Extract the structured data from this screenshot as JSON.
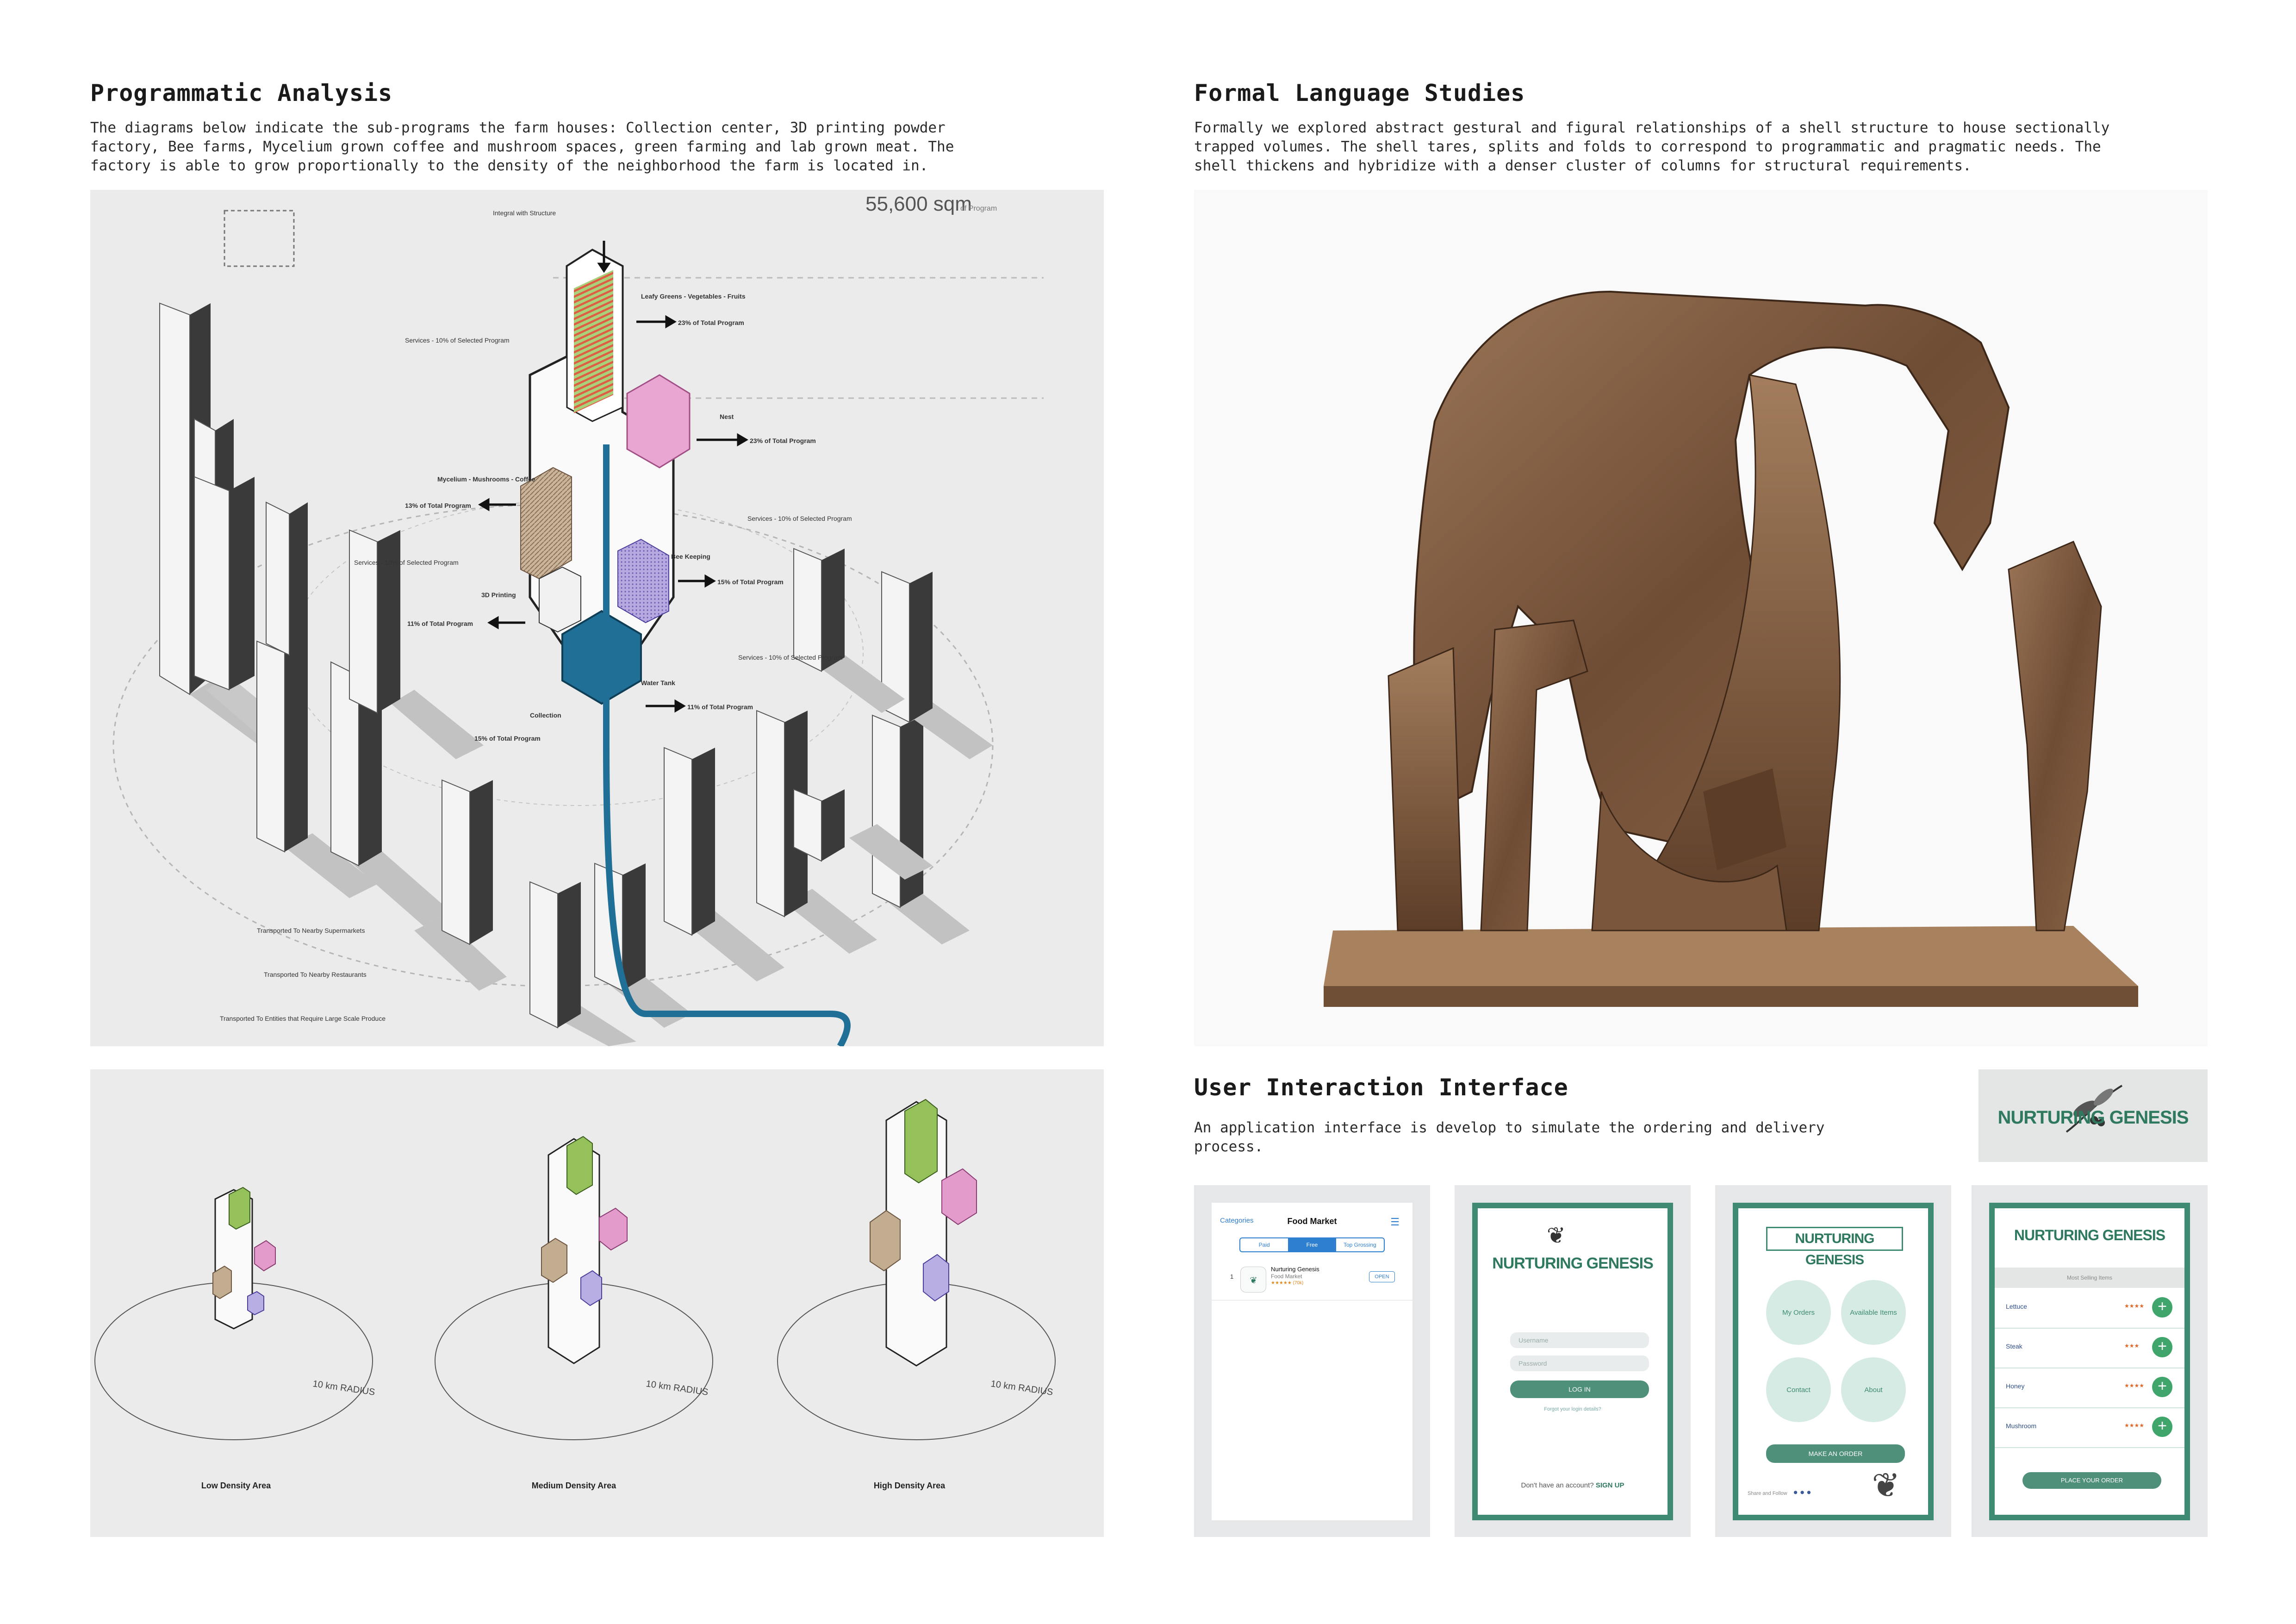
{
  "left": {
    "title": "Programmatic Analysis",
    "lines": [
      "The diagrams below indicate the sub-programs the farm houses: Collection center, 3D printing powder",
      "factory, Bee farms, Mycelium grown coffee and mushroom spaces, green farming and lab grown meat. The",
      "factory is able to grow proportionally to the density of the neighborhood the farm is located in."
    ],
    "diagram": {
      "area": "55,600 sqm",
      "area_note": "of Program",
      "labels": {
        "integral": "Integral with Structure",
        "leafy": "Leafy Greens - Vegetables - Fruits",
        "p23": "23% of Total Program",
        "nest": "Nest",
        "p23b": "23% of Total Program",
        "mycelium": "Mycelium - Mushrooms - Coffee",
        "p13": "13% of Total Program",
        "bee": "Bee Keeping",
        "p15": "15% of Total Program",
        "printing": "3D Printing",
        "p11": "11% of Total Program",
        "water": "Water Tank",
        "p11b": "11% of Total Program",
        "collection": "Collection",
        "p15b": "15% of Total Program",
        "services1": "Services - 10% of Selected Program",
        "services2": "Services - 10% of Selected Program",
        "services3": "Services - 10% of Selected Program",
        "services4": "Services - 10% of Selected Program",
        "t1": "Transported To Nearby Supermarkets",
        "t2": "Transported To Nearby Restaurants",
        "t3": "Transported To Entities that Require Large Scale Produce"
      }
    },
    "density": {
      "radius": "10 km RADIUS",
      "labels": [
        "Low Density Area",
        "Medium Density Area",
        "High Density Area"
      ]
    }
  },
  "right": {
    "title": "Formal Language Studies",
    "lines": [
      "Formally we explored abstract gestural and figural relationships of a shell structure to house sectionally",
      "trapped volumes. The shell tares, splits and folds to correspond to programmatic and pragmatic needs. The",
      "shell thickens and hybridize with a denser cluster of columns for structural requirements."
    ]
  },
  "ui": {
    "title": "User Interaction Interface",
    "lines": [
      "An application interface is develop to simulate the ordering and delivery",
      "process."
    ],
    "logo": "NURTURING GENESIS",
    "screen1": {
      "back": "Categories",
      "title": "Food Market",
      "segments": [
        "Paid",
        "Free",
        "Top Grossing"
      ],
      "rank": "1",
      "app_name": "Nurturing Genesis",
      "app_cat": "Food Market",
      "rating": "★★★★★ (70k)",
      "open": "OPEN"
    },
    "screen2": {
      "brand": "NURTURING GENESIS",
      "username": "Username",
      "password": "Password",
      "login": "LOG IN",
      "forgot": "Forgot your login details?",
      "no_account": "Don't have an account?",
      "signup": "SIGN UP"
    },
    "screen3": {
      "brand": "NURTURING GENESIS",
      "circles": [
        "My Orders",
        "Available Items",
        "Contact",
        "About"
      ],
      "order": "MAKE AN ORDER",
      "share": "Share and Follow"
    },
    "screen4": {
      "brand": "NURTURING GENESIS",
      "header": "Most Selling Items",
      "items": [
        {
          "name": "Lettuce",
          "stars": "★★★★"
        },
        {
          "name": "Steak",
          "stars": "★★★"
        },
        {
          "name": "Honey",
          "stars": "★★★★"
        },
        {
          "name": "Mushroom",
          "stars": "★★★★"
        }
      ],
      "place": "PLACE YOUR ORDER"
    }
  }
}
